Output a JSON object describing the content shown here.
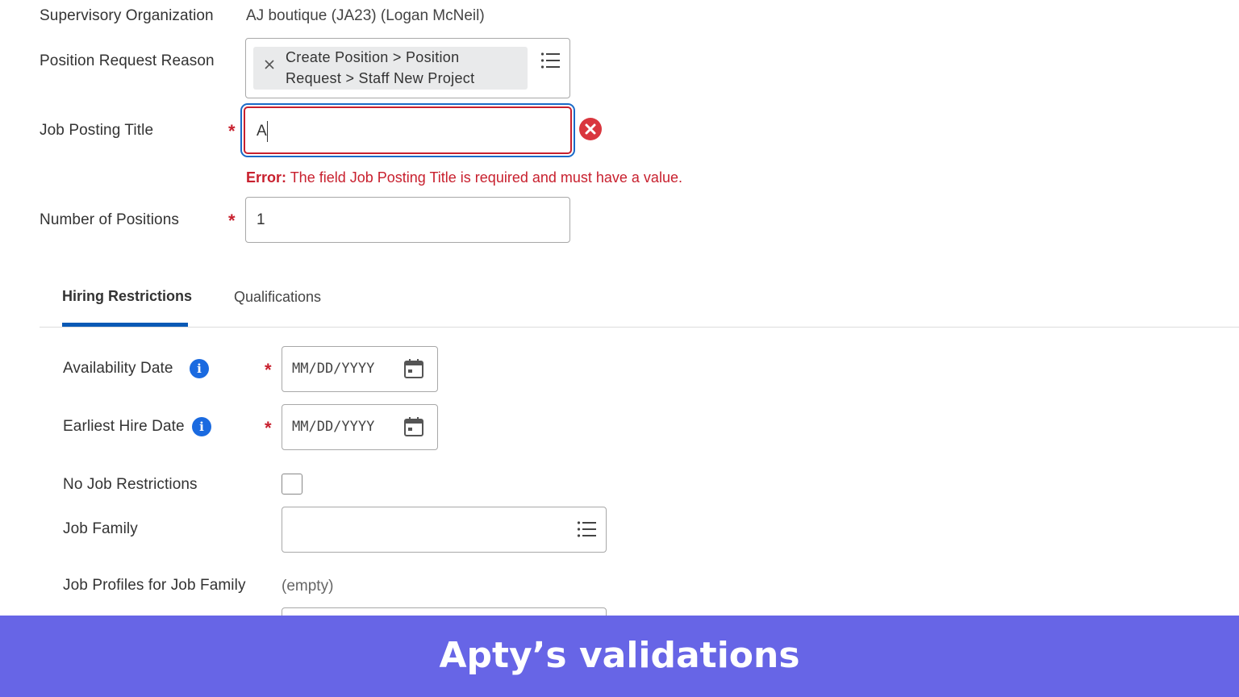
{
  "form": {
    "supervisory_org": {
      "label": "Supervisory Organization",
      "value": "AJ boutique (JA23) (Logan McNeil)"
    },
    "position_request_reason": {
      "label": "Position Request Reason",
      "selected_line1": "Create Position > Position",
      "selected_line2": "Request > Staff New Project",
      "remove_glyph": "×"
    },
    "job_posting_title": {
      "label": "Job Posting Title",
      "required_mark": "*",
      "value": "A",
      "error_prefix": "Error:",
      "error_message": " The field Job Posting Title is required and must have a value."
    },
    "number_of_positions": {
      "label": "Number of Positions",
      "required_mark": "*",
      "value": "1"
    }
  },
  "tabs": [
    {
      "label": "Hiring Restrictions",
      "active": true
    },
    {
      "label": "Qualifications",
      "active": false
    }
  ],
  "hiring_restrictions": {
    "availability_date": {
      "label": "Availability Date",
      "required_mark": "*",
      "placeholder": "MM/DD/YYYY",
      "info": "i"
    },
    "earliest_hire_date": {
      "label": "Earliest Hire Date",
      "required_mark": "*",
      "placeholder": "MM/DD/YYYY",
      "info": "i"
    },
    "no_job_restrictions": {
      "label": "No Job Restrictions",
      "checked": false
    },
    "job_family": {
      "label": "Job Family",
      "value": ""
    },
    "job_profiles": {
      "label": "Job Profiles for Job Family",
      "value": "(empty)"
    }
  },
  "banner": {
    "text": "Apty’s validations",
    "color": "#6765e6"
  },
  "colors": {
    "error": "#c8202e",
    "accent": "#0a59b5",
    "info": "#1a6ae0"
  },
  "icons": [
    "close-icon",
    "list-icon",
    "error-circle-icon",
    "info-icon",
    "calendar-icon"
  ]
}
